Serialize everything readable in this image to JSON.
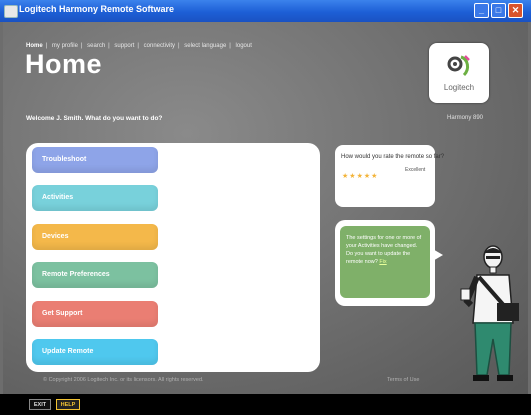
{
  "window": {
    "title": "Logitech Harmony Remote Software",
    "min_symbol": "_",
    "max_symbol": "□",
    "close_symbol": "✕"
  },
  "nav": {
    "items": [
      "Home",
      "my profile",
      "search",
      "support",
      "connectivity",
      "select language",
      "logout"
    ],
    "separator": "|"
  },
  "page": {
    "title": "Home",
    "welcome": "Welcome J. Smith. What do you want to do?",
    "remote_name": "Harmony 890"
  },
  "logo": {
    "text": "Logitech"
  },
  "menu": [
    {
      "label": "Troubleshoot"
    },
    {
      "label": "Activities"
    },
    {
      "label": "Devices"
    },
    {
      "label": "Remote Preferences"
    },
    {
      "label": "Get Support"
    },
    {
      "label": "Update Remote"
    }
  ],
  "rating": {
    "question": "How would you rate the remote so far?",
    "stars": 5,
    "value_text": "Excellent"
  },
  "notification": {
    "text": "The settings for one or more of your Activities have changed. Do you want to update the remote now?",
    "link": "Fix"
  },
  "footer": {
    "copyright": "© Copyright 2006 Logitech Inc. or its licensors. All rights reserved.",
    "terms": "Terms of Use"
  },
  "bottom": {
    "exit": "EXIT",
    "help": "HELP"
  },
  "colors": {
    "troubleshoot": "#8ea4e8",
    "activities": "#78d1db",
    "devices": "#f4b84a",
    "remote_preferences": "#7cc1a0",
    "get_support": "#ea7e73",
    "update_remote": "#4fc8ee",
    "notification": "#7fb069",
    "titlebar": "#1d5fd6"
  }
}
